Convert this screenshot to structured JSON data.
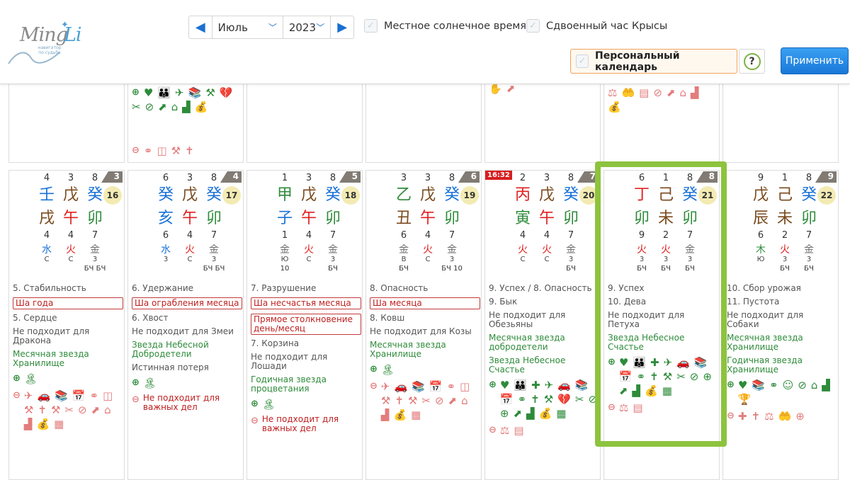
{
  "header": {
    "logo": {
      "word1": "Ming",
      "word2": "Li",
      "tagline_1": "навигатор",
      "tagline_2": "по судьбе"
    },
    "month": "Июль",
    "year": "2023",
    "solar_time_label": "Местное солнечное время",
    "double_rat_label": "Сдвоенный час Крысы",
    "personal_calendar_label": "Персональный календарь",
    "help_label": "?",
    "apply_label": "Применить"
  },
  "top_cells": [
    {
      "icons": []
    },
    {
      "icons_plus": [
        "heart-icon",
        "people-icon",
        "plane-icon",
        "books-icon",
        "tools-icon",
        "broken-heart-icon",
        "scissors-icon",
        "no-car-icon",
        "arrow-up-icon",
        "house-icon",
        "chart-icon",
        "moneybag-icon"
      ],
      "icons_minus": [
        "rings-icon",
        "door-icon",
        "shovel-icon",
        "grave-icon"
      ]
    },
    {
      "icons": []
    },
    {
      "icons": []
    },
    {
      "icons_minus": [
        "hand-icon",
        "arrow-up-icon"
      ]
    },
    {
      "icons_minus": [
        "scales-icon",
        "hand-coin-icon",
        "demolish-icon",
        "no-car-icon",
        "arrow-up-icon",
        "house-icon",
        "chart-icon",
        "moneybag-icon"
      ]
    },
    {
      "icons": []
    }
  ],
  "days": [
    {
      "badge": "3",
      "date": "16",
      "time": "",
      "nums_top": [
        "4",
        "3",
        "8"
      ],
      "stems": [
        {
          "ch": "壬",
          "el": "water"
        },
        {
          "ch": "戊",
          "el": "earth"
        },
        {
          "ch": "癸",
          "el": "water"
        }
      ],
      "branches": [
        {
          "ch": "戌",
          "el": "earth"
        },
        {
          "ch": "午",
          "el": "fire"
        },
        {
          "ch": "卯",
          "el": "wood"
        }
      ],
      "nums_bottom": [
        "4",
        "4",
        "7"
      ],
      "elements": [
        {
          "ch": "水",
          "el": "water"
        },
        {
          "ch": "火",
          "el": "fire"
        },
        {
          "ch": "金",
          "el": "metal"
        }
      ],
      "el_tags": [
        "С",
        "С",
        "3"
      ],
      "bch": [
        "",
        "",
        "БЧ БЧ"
      ],
      "lines": [
        "5. Стабильность"
      ],
      "boxed": [
        "Ша года"
      ],
      "lines2": [
        "5. Сердце",
        "Не подходит для Дракона"
      ],
      "green": [
        "Месячная звезда Хранилище"
      ],
      "plus_icons": [
        "island-icon"
      ],
      "warn": "",
      "minus_icons": [
        "plane-icon",
        "car-icon",
        "books-icon",
        "calendar-icon",
        "rings-icon",
        "door-icon",
        "shovel-icon",
        "grave-icon",
        "tools-icon",
        "scissors-icon",
        "no-car-icon",
        "arrow-up-icon",
        "house-icon",
        "chart-icon",
        "moneybag-icon",
        "certificate-icon"
      ]
    },
    {
      "badge": "4",
      "date": "17",
      "time": "",
      "nums_top": [
        "6",
        "3",
        "8"
      ],
      "stems": [
        {
          "ch": "癸",
          "el": "water"
        },
        {
          "ch": "戊",
          "el": "earth"
        },
        {
          "ch": "癸",
          "el": "water"
        }
      ],
      "branches": [
        {
          "ch": "亥",
          "el": "water"
        },
        {
          "ch": "午",
          "el": "fire"
        },
        {
          "ch": "卯",
          "el": "wood"
        }
      ],
      "nums_bottom": [
        "6",
        "4",
        "7"
      ],
      "elements": [
        {
          "ch": "水",
          "el": "water"
        },
        {
          "ch": "火",
          "el": "fire"
        },
        {
          "ch": "金",
          "el": "metal"
        }
      ],
      "el_tags": [
        "3",
        "С",
        "3"
      ],
      "bch": [
        "",
        "",
        "БЧ БЧ"
      ],
      "lines": [
        "6. Удержание"
      ],
      "boxed": [
        "Ша ограбления месяца"
      ],
      "lines2": [
        "6. Хвост",
        "Не подходит для Змеи"
      ],
      "green": [
        "Звезда Небесной Добродетели"
      ],
      "lines3": [
        "Истинная потеря"
      ],
      "plus_icons": [
        "island-icon"
      ],
      "warn": "Не подходит для важных дел",
      "minus_icons": []
    },
    {
      "badge": "5",
      "date": "18",
      "time": "",
      "nums_top": [
        "1",
        "3",
        "8"
      ],
      "stems": [
        {
          "ch": "甲",
          "el": "wood"
        },
        {
          "ch": "戊",
          "el": "earth"
        },
        {
          "ch": "癸",
          "el": "water"
        }
      ],
      "branches": [
        {
          "ch": "子",
          "el": "water"
        },
        {
          "ch": "午",
          "el": "fire"
        },
        {
          "ch": "卯",
          "el": "wood"
        }
      ],
      "nums_bottom": [
        "1",
        "4",
        "7"
      ],
      "elements": [
        {
          "ch": "金",
          "el": "metal"
        },
        {
          "ch": "火",
          "el": "fire"
        },
        {
          "ch": "金",
          "el": "metal"
        }
      ],
      "el_tags": [
        "Ю",
        "С",
        "3"
      ],
      "bch": [
        "10",
        "",
        "БЧ"
      ],
      "lines": [
        "7. Разрушение"
      ],
      "boxed": [
        "Ша несчастья месяца",
        "Прямое столкновение день/месяц"
      ],
      "lines2": [
        "7. Корзина",
        "Не подходит для Лошади"
      ],
      "green": [
        "Годичная звезда процветания"
      ],
      "plus_icons": [
        "island-icon"
      ],
      "warn": "Не подходит для важных дел",
      "minus_icons": []
    },
    {
      "badge": "6",
      "date": "19",
      "time": "",
      "nums_top": [
        "3",
        "3",
        "8"
      ],
      "stems": [
        {
          "ch": "乙",
          "el": "wood"
        },
        {
          "ch": "戊",
          "el": "earth"
        },
        {
          "ch": "癸",
          "el": "water"
        }
      ],
      "branches": [
        {
          "ch": "丑",
          "el": "earth"
        },
        {
          "ch": "午",
          "el": "fire"
        },
        {
          "ch": "卯",
          "el": "wood"
        }
      ],
      "nums_bottom": [
        "6",
        "4",
        "7"
      ],
      "elements": [
        {
          "ch": "金",
          "el": "metal"
        },
        {
          "ch": "火",
          "el": "fire"
        },
        {
          "ch": "金",
          "el": "metal"
        }
      ],
      "el_tags": [
        "В",
        "С",
        "3"
      ],
      "bch": [
        "БЧ",
        "",
        "БЧ 10"
      ],
      "lines": [
        "8. Опасность"
      ],
      "boxed": [
        "Ша месяца"
      ],
      "lines2": [
        "8. Ковш",
        "Не подходит для Козы"
      ],
      "green": [
        "Месячная звезда Хранилище"
      ],
      "plus_icons": [
        "island-icon"
      ],
      "warn": "",
      "minus_icons": [
        "plane-icon",
        "car-icon",
        "books-icon",
        "calendar-icon",
        "rings-icon",
        "door-icon",
        "shovel-icon",
        "grave-icon",
        "tools-icon",
        "scissors-icon",
        "no-car-icon",
        "arrow-up-icon",
        "house-icon",
        "chart-icon",
        "moneybag-icon",
        "certificate-icon"
      ]
    },
    {
      "badge": "7",
      "date": "20",
      "time": "16:32",
      "nums_top": [
        "2",
        "3",
        "8"
      ],
      "stems": [
        {
          "ch": "丙",
          "el": "fire"
        },
        {
          "ch": "戊",
          "el": "earth"
        },
        {
          "ch": "癸",
          "el": "water"
        }
      ],
      "branches": [
        {
          "ch": "寅",
          "el": "wood"
        },
        {
          "ch": "午",
          "el": "fire"
        },
        {
          "ch": "卯",
          "el": "wood"
        }
      ],
      "nums_bottom": [
        "4",
        "4",
        "7"
      ],
      "elements": [
        {
          "ch": "火",
          "el": "fire"
        },
        {
          "ch": "火",
          "el": "fire"
        },
        {
          "ch": "金",
          "el": "metal"
        }
      ],
      "el_tags": [
        "С",
        "С",
        "3"
      ],
      "bch": [
        "",
        "",
        "БЧ"
      ],
      "lines": [
        "9. Успех / 8. Опасность",
        "9. Бык",
        "Не подходит для Обезьяны"
      ],
      "boxed": [],
      "green": [
        "Месячная звезда добродетели",
        "Звезда Небесное Счастье"
      ],
      "plus_icons": [
        "heart-icon",
        "people-icon",
        "cross-icon",
        "plane-icon",
        "car-icon",
        "books-icon",
        "calendar-icon",
        "rings-icon",
        "grave-icon",
        "tools-icon",
        "broken-heart-icon",
        "scissors-icon",
        "no-car-icon",
        "search-icon",
        "arrow-up-icon",
        "chart-icon",
        "moneybag-icon",
        "certificate-icon"
      ],
      "warn": "",
      "minus_icons": [
        "scales-icon",
        "demolish-icon"
      ]
    },
    {
      "badge": "8",
      "date": "21",
      "time": "",
      "nums_top": [
        "6",
        "1",
        "8"
      ],
      "stems": [
        {
          "ch": "丁",
          "el": "fire"
        },
        {
          "ch": "己",
          "el": "earth"
        },
        {
          "ch": "癸",
          "el": "water"
        }
      ],
      "branches": [
        {
          "ch": "卯",
          "el": "wood"
        },
        {
          "ch": "未",
          "el": "earth"
        },
        {
          "ch": "卯",
          "el": "wood"
        }
      ],
      "nums_bottom": [
        "9",
        "2",
        "7"
      ],
      "elements": [
        {
          "ch": "火",
          "el": "fire"
        },
        {
          "ch": "火",
          "el": "fire"
        },
        {
          "ch": "金",
          "el": "metal"
        }
      ],
      "el_tags": [
        "3",
        "3",
        "3"
      ],
      "bch": [
        "БЧ",
        "БЧ",
        "БЧ"
      ],
      "lines": [
        "9. Успех",
        "10. Дева",
        "Не подходит для Петуха"
      ],
      "boxed": [],
      "green": [
        "Звезда Небесное Счастье"
      ],
      "plus_icons": [
        "heart-icon",
        "people-icon",
        "cross-icon",
        "plane-icon",
        "car-icon",
        "books-icon",
        "calendar-icon",
        "rings-icon",
        "grave-icon",
        "tools-icon",
        "scissors-icon",
        "no-car-icon",
        "search-icon",
        "arrow-up-icon",
        "chart-icon",
        "moneybag-icon",
        "certificate-icon"
      ],
      "warn": "",
      "minus_icons": [
        "scales-icon",
        "demolish-icon"
      ]
    },
    {
      "badge": "9",
      "date": "22",
      "time": "",
      "nums_top": [
        "9",
        "1",
        "8"
      ],
      "stems": [
        {
          "ch": "戊",
          "el": "earth"
        },
        {
          "ch": "己",
          "el": "earth"
        },
        {
          "ch": "癸",
          "el": "water"
        }
      ],
      "branches": [
        {
          "ch": "辰",
          "el": "earth"
        },
        {
          "ch": "未",
          "el": "earth"
        },
        {
          "ch": "卯",
          "el": "wood"
        }
      ],
      "nums_bottom": [
        "6",
        "2",
        "7"
      ],
      "elements": [
        {
          "ch": "木",
          "el": "wood"
        },
        {
          "ch": "火",
          "el": "fire"
        },
        {
          "ch": "金",
          "el": "metal"
        }
      ],
      "el_tags": [
        "Ю",
        "3",
        "3"
      ],
      "bch": [
        "",
        "БЧ",
        "БЧ"
      ],
      "lines": [
        "10. Сбор урожая",
        "11. Пустота",
        "Не подходит для Собаки"
      ],
      "boxed": [],
      "green": [
        "Месячная звезда Хранилище",
        "Годичная звезда Хранилище"
      ],
      "plus_icons": [
        "heart-icon",
        "books-icon",
        "rings-icon",
        "face-icon",
        "no-car-icon",
        "house-icon",
        "chart-icon",
        "trophy-icon"
      ],
      "warn": "",
      "minus_icons": [
        "cross-icon",
        "grave-icon",
        "scales-icon",
        "hand-coin-icon",
        "search-icon"
      ]
    }
  ],
  "colors": {
    "wood": "#2e8b3a",
    "fire": "#e02020",
    "earth": "#7a4a1e",
    "metal": "#707070",
    "water": "#1a72d8",
    "positive": "#2e8b3a",
    "negative": "#e37c7c",
    "highlight": "#8dc33e",
    "accent": "#1a78d8"
  }
}
